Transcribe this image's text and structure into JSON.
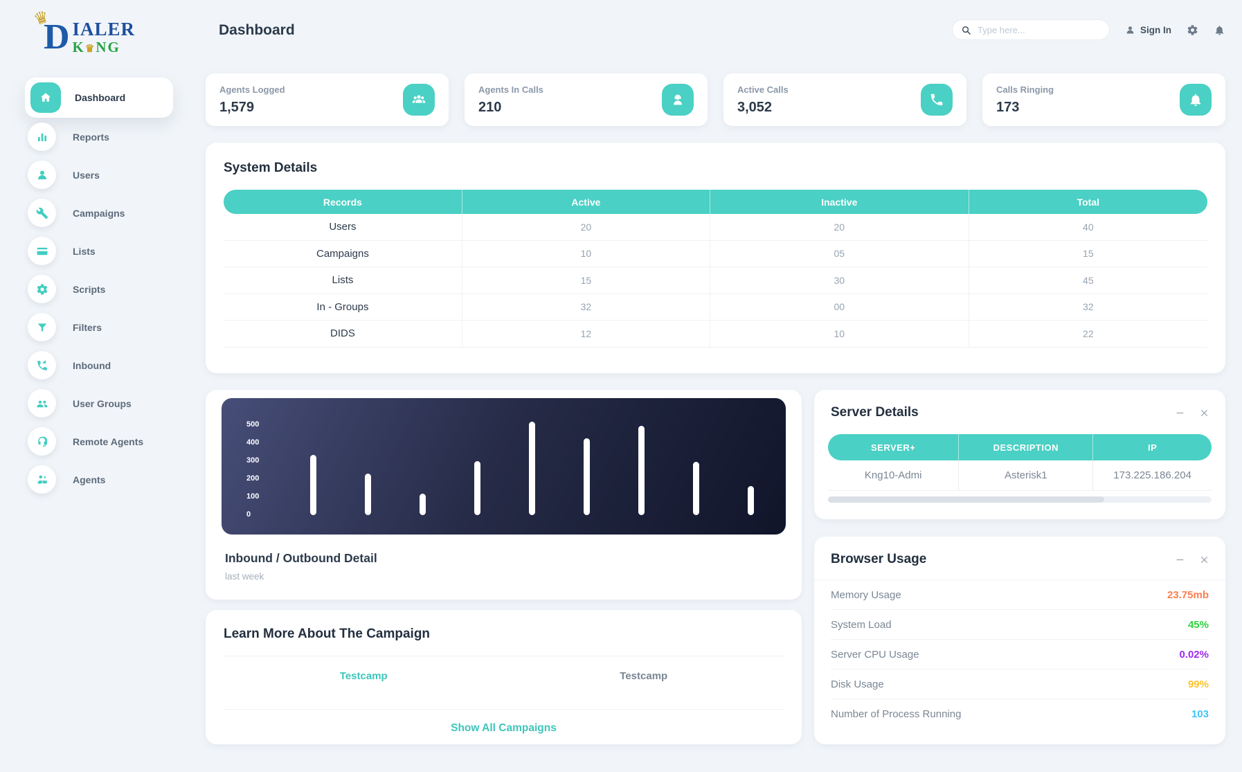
{
  "app": {
    "logo_d": "D",
    "logo_line1": "IALER",
    "logo_king_k": "K",
    "logo_king_ng": "NG",
    "logo_crown": "♛"
  },
  "header": {
    "page_title": "Dashboard",
    "search_placeholder": "Type here...",
    "sign_in_label": "Sign In"
  },
  "sidebar": {
    "items": [
      {
        "label": "Dashboard",
        "icon": "home-icon",
        "active": true
      },
      {
        "label": "Reports",
        "icon": "bar-chart-icon",
        "active": false
      },
      {
        "label": "Users",
        "icon": "user-icon",
        "active": false
      },
      {
        "label": "Campaigns",
        "icon": "wrench-icon",
        "active": false
      },
      {
        "label": "Lists",
        "icon": "credit-card-icon",
        "active": false
      },
      {
        "label": "Scripts",
        "icon": "gear-code-icon",
        "active": false
      },
      {
        "label": "Filters",
        "icon": "filter-icon",
        "active": false
      },
      {
        "label": "Inbound",
        "icon": "phone-incoming-icon",
        "active": false
      },
      {
        "label": "User Groups",
        "icon": "user-group-icon",
        "active": false
      },
      {
        "label": "Remote Agents",
        "icon": "headset-icon",
        "active": false
      },
      {
        "label": "Agents",
        "icon": "agent-desk-icon",
        "active": false
      }
    ]
  },
  "stats": [
    {
      "label": "Agents Logged",
      "value": "1,579",
      "icon": "agents-group-icon"
    },
    {
      "label": "Agents In Calls",
      "value": "210",
      "icon": "agent-headset-icon"
    },
    {
      "label": "Active Calls",
      "value": "3,052",
      "icon": "phone-icon"
    },
    {
      "label": "Calls Ringing",
      "value": "173",
      "icon": "bell-icon"
    }
  ],
  "system_details": {
    "title": "System Details",
    "columns": [
      "Records",
      "Active",
      "Inactive",
      "Total"
    ],
    "rows": [
      [
        "Users",
        "20",
        "20",
        "40"
      ],
      [
        "Campaigns",
        "10",
        "05",
        "15"
      ],
      [
        "Lists",
        "15",
        "30",
        "45"
      ],
      [
        "In - Groups",
        "32",
        "00",
        "32"
      ],
      [
        "DIDS",
        "12",
        "10",
        "22"
      ]
    ]
  },
  "chart_data": {
    "type": "bar",
    "title": "Inbound / Outbound Detail",
    "subtitle": "last week",
    "values": [
      335,
      230,
      120,
      300,
      520,
      425,
      495,
      295,
      160
    ],
    "yticks": [
      500,
      400,
      300,
      200,
      100,
      0
    ],
    "ylim": [
      0,
      550
    ],
    "xlabel": "",
    "ylabel": "",
    "grid": false,
    "legend": false,
    "bar_color": "#ffffff",
    "background_gradient": [
      "#474e78",
      "#10152a"
    ]
  },
  "campaigns_card": {
    "title": "Learn More About The Campaign",
    "links": [
      {
        "label": "Testcamp",
        "style": "teal"
      },
      {
        "label": "Testcamp",
        "style": "gray"
      }
    ],
    "show_all_label": "Show All Campaigns"
  },
  "server_details": {
    "title": "Server Details",
    "columns": [
      "SERVER+",
      "DESCRIPTION",
      "IP"
    ],
    "rows": [
      [
        "Kng10-Admi",
        "Asterisk1",
        "173.225.186.204"
      ]
    ]
  },
  "browser_usage": {
    "title": "Browser Usage",
    "rows": [
      {
        "label": "Memory Usage",
        "value": "23.75mb",
        "color": "#fd7e50"
      },
      {
        "label": "System Load",
        "value": "45%",
        "color": "#2ed63e"
      },
      {
        "label": "Server CPU Usage",
        "value": "0.02%",
        "color": "#9d2bf2"
      },
      {
        "label": "Disk Usage",
        "value": "99%",
        "color": "#fec32d"
      },
      {
        "label": "Number of Process Running",
        "value": "103",
        "color": "#3ec3fb"
      }
    ]
  },
  "colors": {
    "accent_teal": "#4ad0c4",
    "page_background": "#f1f5f9",
    "dark_text": "#2c3a4b",
    "muted_text": "#8b98a9"
  }
}
